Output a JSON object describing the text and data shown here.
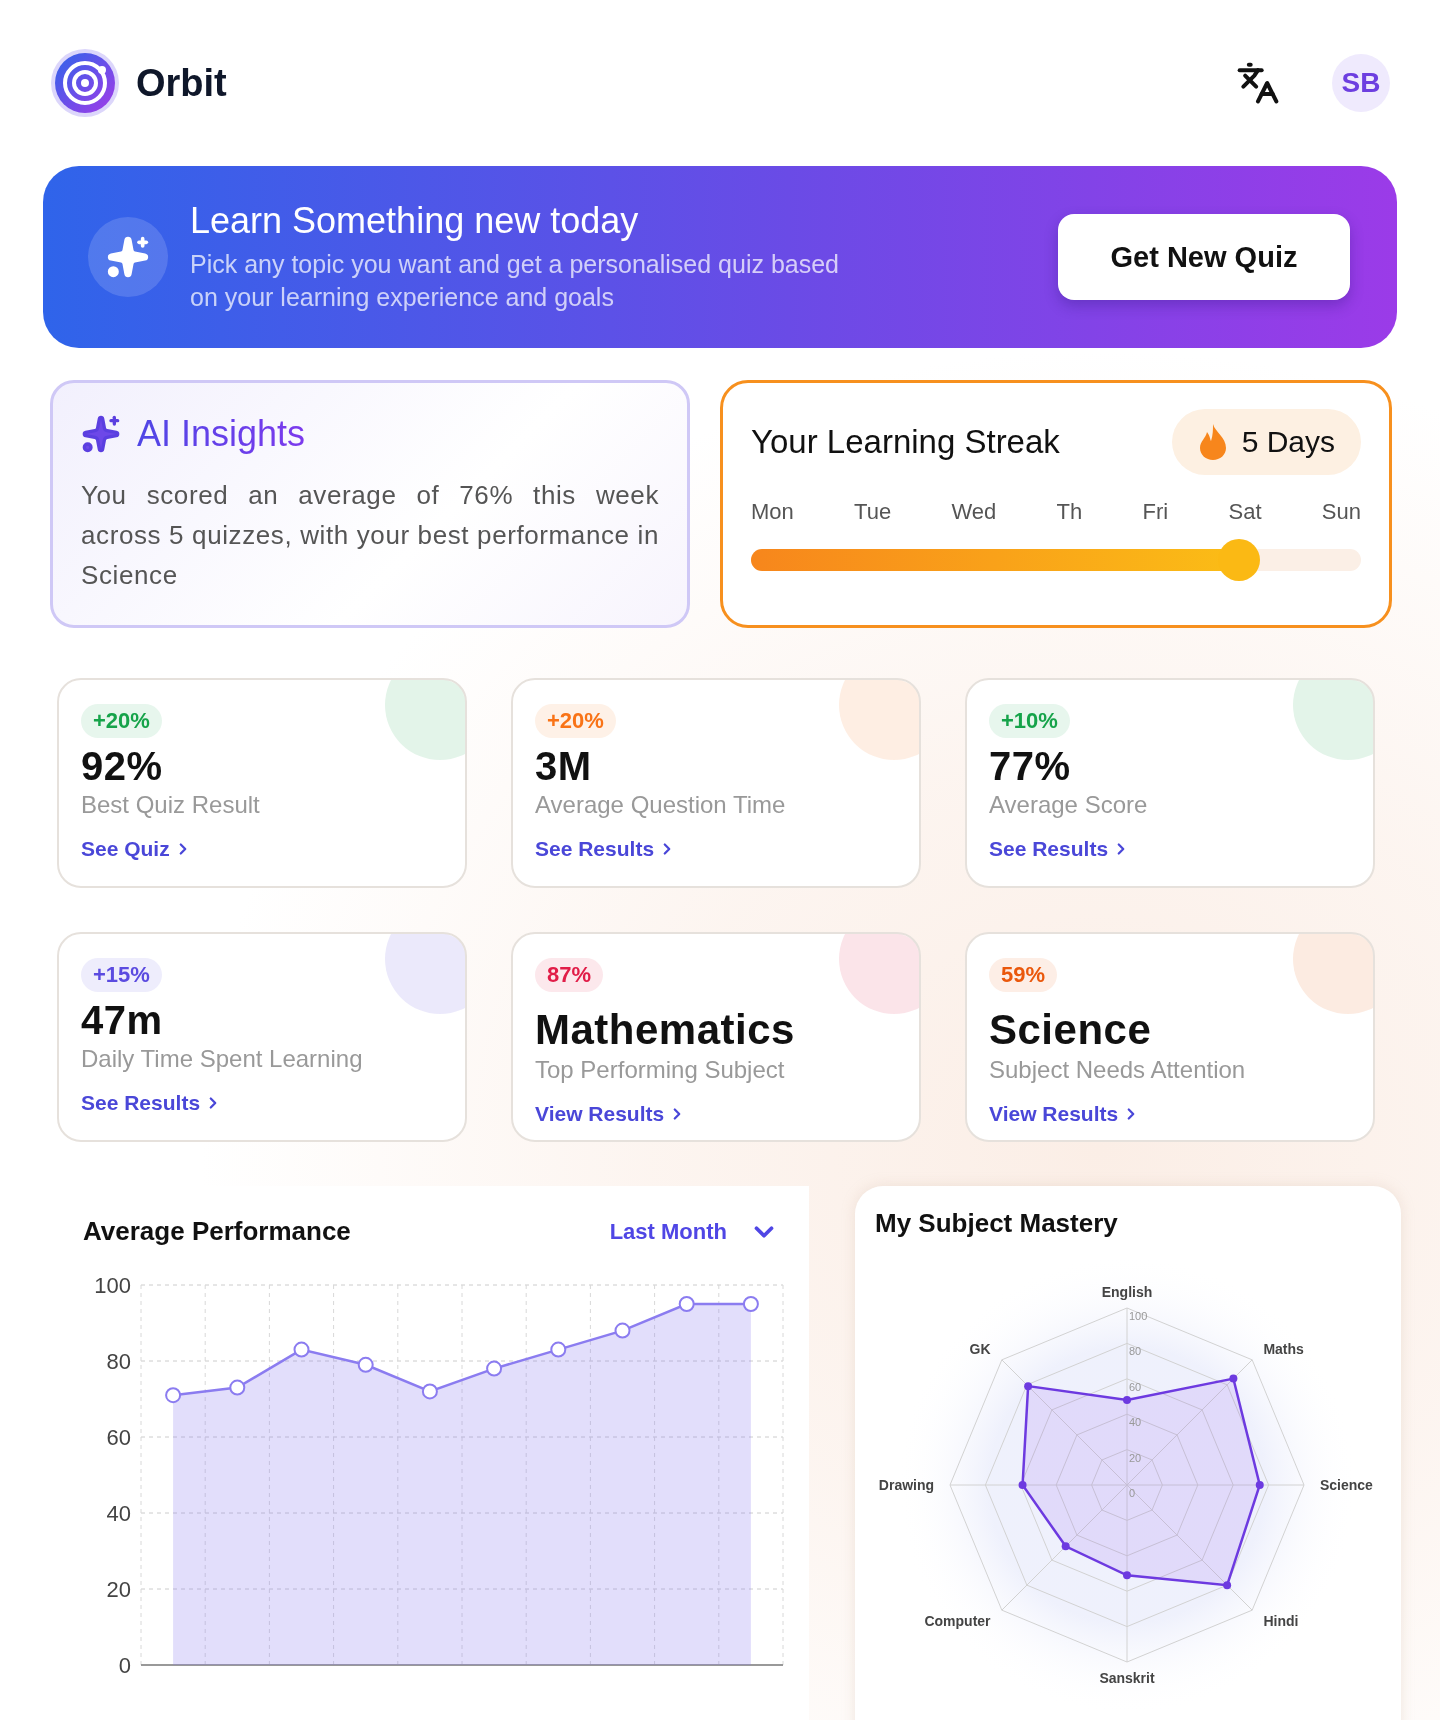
{
  "app": {
    "name": "Orbit",
    "avatar": "SB"
  },
  "banner": {
    "title": "Learn Something new today",
    "subtitle": "Pick any topic you want and get a personalised quiz based on your learning experience and goals",
    "button": "Get New Quiz"
  },
  "insights": {
    "title_prefix": "AI",
    "title": "Insights",
    "text": "You scored an average of 76% this week across 5 quizzes, with your best performance in Science"
  },
  "streak": {
    "title": "Your Learning Streak",
    "badge": "5 Days",
    "days": [
      "Mon",
      "Tue",
      "Wed",
      "Th",
      "Fri",
      "Sat",
      "Sun"
    ],
    "level": 0.8
  },
  "stats": [
    {
      "badge": "+20%",
      "color": "#16a34a",
      "value": "92%",
      "label": "Best Quiz Result",
      "link": "See Quiz"
    },
    {
      "badge": "+20%",
      "color": "#f97316",
      "value": "3M",
      "label": "Average Question Time",
      "link": "See Results"
    },
    {
      "badge": "+10%",
      "color": "#16a34a",
      "value": "77%",
      "label": "Average Score",
      "link": "See Results"
    },
    {
      "badge": "+15%",
      "color": "#5b4be0",
      "value": "47m",
      "label": "Daily Time Spent Learning",
      "link": "See Results"
    },
    {
      "badge": "87%",
      "color": "#e11d48",
      "value": "Mathematics",
      "label": "Top Performing Subject",
      "link": "View Results"
    },
    {
      "badge": "59%",
      "color": "#ea580c",
      "value": "Science",
      "label": "Subject Needs Attention",
      "link": "View Results"
    }
  ],
  "performance": {
    "title": "Average Performance",
    "filter": "Last Month",
    "chart_data": {
      "type": "area",
      "categories": [
        null,
        null,
        null,
        null,
        null,
        null,
        null,
        null,
        null,
        null
      ],
      "ylim": [
        0,
        100
      ],
      "yticks": [
        0,
        20,
        40,
        60,
        80,
        100
      ],
      "grid": true,
      "series": [
        {
          "color": "#8b7cf0",
          "values": [
            71,
            73,
            83,
            79,
            72,
            78,
            83,
            88,
            95,
            95
          ]
        }
      ]
    }
  },
  "mastery": {
    "title": "My Subject Mastery",
    "ticks": [
      "100",
      "80",
      "60",
      "40",
      "20",
      "0"
    ],
    "subjects": [
      "English",
      "Maths",
      "Science",
      "Hindi",
      "Sanskrit",
      "Computer",
      "Drawing",
      "GK"
    ]
  }
}
